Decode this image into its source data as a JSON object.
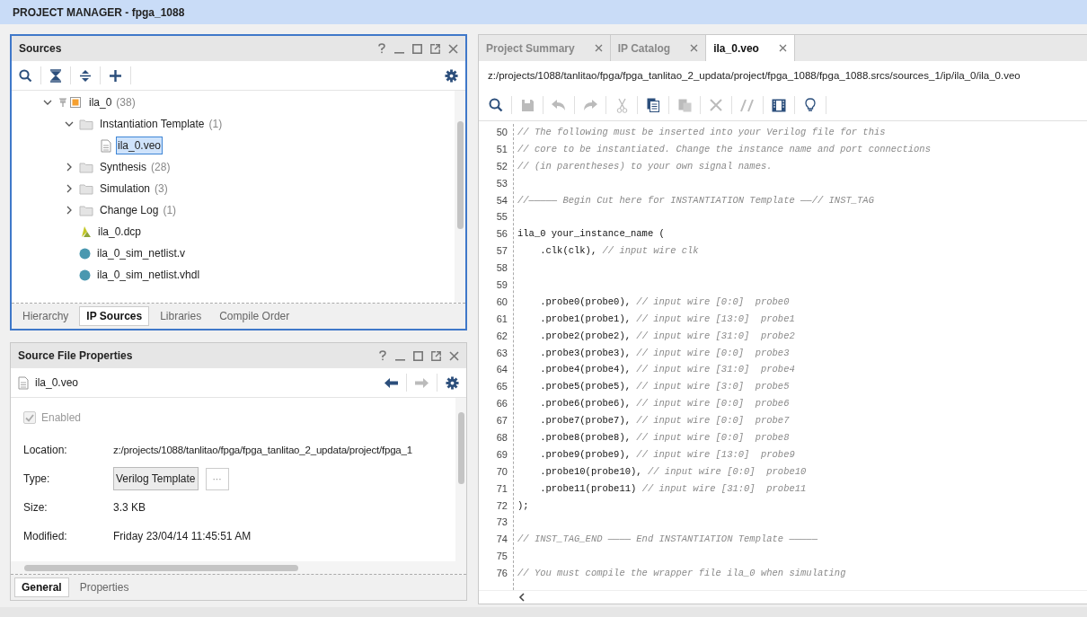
{
  "window": {
    "title": "PROJECT MANAGER - fpga_1088"
  },
  "sources": {
    "title": "Sources",
    "tree": [
      {
        "label": "ila_0",
        "count": "(38)",
        "kind": "ip",
        "expanded": true,
        "selected": false,
        "children": [
          {
            "label": "Instantiation Template",
            "count": "(1)",
            "kind": "folder",
            "expanded": true,
            "selected": false,
            "children": [
              {
                "label": "ila_0.veo",
                "kind": "doc",
                "selected": true
              }
            ]
          },
          {
            "label": "Synthesis",
            "count": "(28)",
            "kind": "folder",
            "expanded": false,
            "selected": false
          },
          {
            "label": "Simulation",
            "count": "(3)",
            "kind": "folder",
            "expanded": false,
            "selected": false
          },
          {
            "label": "Change Log",
            "count": "(1)",
            "kind": "folder",
            "expanded": false,
            "selected": false
          },
          {
            "label": "ila_0.dcp",
            "kind": "dcp",
            "selected": false
          },
          {
            "label": "ila_0_sim_netlist.v",
            "kind": "netlist",
            "selected": false
          },
          {
            "label": "ila_0_sim_netlist.vhdl",
            "kind": "netlist",
            "selected": false
          }
        ]
      }
    ],
    "tabs": [
      {
        "label": "Hierarchy",
        "selected": false
      },
      {
        "label": "IP Sources",
        "selected": true
      },
      {
        "label": "Libraries",
        "selected": false
      },
      {
        "label": "Compile Order",
        "selected": false
      }
    ]
  },
  "properties": {
    "title": "Source File Properties",
    "file": "ila_0.veo",
    "enabled": {
      "label": "Enabled",
      "checked": true,
      "disabled": true
    },
    "location": {
      "label": "Location:",
      "value": "z:/projects/1088/tanlitao/fpga/fpga_tanlitao_2_updata/project/fpga_1"
    },
    "type": {
      "label": "Type:",
      "value": "Verilog Template",
      "more": "···"
    },
    "size": {
      "label": "Size:",
      "value": "3.3 KB"
    },
    "modified": {
      "label": "Modified:",
      "value": "Friday 23/04/14 11:45:51 AM"
    },
    "tabs": [
      {
        "label": "General",
        "selected": true
      },
      {
        "label": "Properties",
        "selected": false
      }
    ]
  },
  "editor": {
    "tabs": [
      {
        "label": "Project Summary",
        "selected": false
      },
      {
        "label": "IP Catalog",
        "selected": false
      },
      {
        "label": "ila_0.veo",
        "selected": true
      }
    ],
    "path": "z:/projects/1088/tanlitao/fpga/fpga_tanlitao_2_updata/project/fpga_1088/fpga_1088.srcs/sources_1/ip/ila_0/ila_0.veo",
    "toolbar": [
      {
        "kind": "search",
        "disabled": false
      },
      {
        "kind": "save",
        "disabled": true
      },
      {
        "kind": "undo",
        "disabled": true
      },
      {
        "kind": "redo",
        "disabled": true
      },
      {
        "kind": "cut",
        "disabled": true
      },
      {
        "kind": "copy",
        "disabled": false
      },
      {
        "kind": "paste",
        "disabled": true
      },
      {
        "kind": "delete",
        "disabled": true
      },
      {
        "kind": "comment",
        "disabled": true
      },
      {
        "kind": "columns",
        "disabled": false
      },
      {
        "kind": "bulb",
        "disabled": false
      }
    ],
    "lines": [
      {
        "n": "50",
        "comment": "// The following must be inserted into your Verilog file for this"
      },
      {
        "n": "51",
        "comment": "// core to be instantiated. Change the instance name and port connections"
      },
      {
        "n": "52",
        "comment": "// (in parentheses) to your own signal names."
      },
      {
        "n": "53"
      },
      {
        "n": "54",
        "comment": "//————— Begin Cut here for INSTANTIATION Template ——// INST_TAG"
      },
      {
        "n": "55"
      },
      {
        "n": "56",
        "code": "ila_0 your_instance_name ("
      },
      {
        "n": "57",
        "code": "    .clk(clk),",
        "comment": " // input wire clk"
      },
      {
        "n": "58"
      },
      {
        "n": "59"
      },
      {
        "n": "60",
        "code": "    .probe0(probe0),",
        "comment": " // input wire [0:0]  probe0"
      },
      {
        "n": "61",
        "code": "    .probe1(probe1),",
        "comment": " // input wire [13:0]  probe1"
      },
      {
        "n": "62",
        "code": "    .probe2(probe2),",
        "comment": " // input wire [31:0]  probe2"
      },
      {
        "n": "63",
        "code": "    .probe3(probe3),",
        "comment": " // input wire [0:0]  probe3"
      },
      {
        "n": "64",
        "code": "    .probe4(probe4),",
        "comment": " // input wire [31:0]  probe4"
      },
      {
        "n": "65",
        "code": "    .probe5(probe5),",
        "comment": " // input wire [3:0]  probe5"
      },
      {
        "n": "66",
        "code": "    .probe6(probe6),",
        "comment": " // input wire [0:0]  probe6"
      },
      {
        "n": "67",
        "code": "    .probe7(probe7),",
        "comment": " // input wire [0:0]  probe7"
      },
      {
        "n": "68",
        "code": "    .probe8(probe8),",
        "comment": " // input wire [0:0]  probe8"
      },
      {
        "n": "69",
        "code": "    .probe9(probe9),",
        "comment": " // input wire [13:0]  probe9"
      },
      {
        "n": "70",
        "code": "    .probe10(probe10),",
        "comment": " // input wire [0:0]  probe10"
      },
      {
        "n": "71",
        "code": "    .probe11(probe11)",
        "comment": " // input wire [31:0]  probe11"
      },
      {
        "n": "72",
        "code": ");"
      },
      {
        "n": "73"
      },
      {
        "n": "74",
        "comment": "// INST_TAG_END ———— End INSTANTIATION Template —————"
      },
      {
        "n": "75"
      },
      {
        "n": "76",
        "comment": "// You must compile the wrapper file ila_0 when simulating"
      }
    ]
  }
}
